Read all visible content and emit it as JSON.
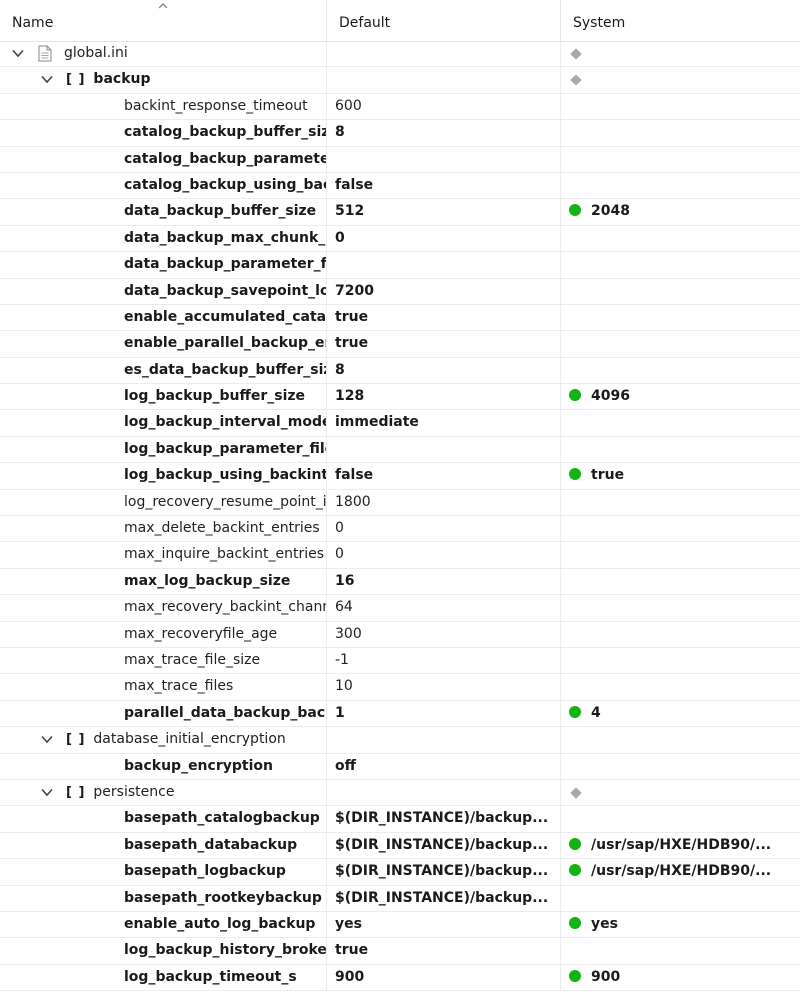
{
  "columns": {
    "name": "Name",
    "default": "Default",
    "system": "System"
  },
  "colors": {
    "green_dot": "#12b312",
    "gray_diamond": "#a9a9a9"
  },
  "rows": [
    {
      "type": "file",
      "name": "global.ini",
      "default": "",
      "system": "",
      "system_marker": "diamond"
    },
    {
      "type": "section",
      "name": "backup",
      "bold": true,
      "default": "",
      "system": "",
      "system_marker": "diamond"
    },
    {
      "type": "param",
      "name": "backint_response_timeout",
      "bold": false,
      "default": "600",
      "system": "",
      "system_marker": ""
    },
    {
      "type": "param",
      "name": "catalog_backup_buffer_size",
      "bold": true,
      "default": "8",
      "system": "",
      "system_marker": ""
    },
    {
      "type": "param",
      "name": "catalog_backup_parameter_file",
      "bold": true,
      "default": "",
      "system": "",
      "system_marker": ""
    },
    {
      "type": "param",
      "name": "catalog_backup_using_backint",
      "bold": true,
      "default": "false",
      "system": "",
      "system_marker": ""
    },
    {
      "type": "param",
      "name": "data_backup_buffer_size",
      "bold": true,
      "default": "512",
      "system": "2048",
      "system_marker": "green"
    },
    {
      "type": "param",
      "name": "data_backup_max_chunk_size",
      "bold": true,
      "default": "0",
      "system": "",
      "system_marker": ""
    },
    {
      "type": "param",
      "name": "data_backup_parameter_file",
      "bold": true,
      "default": "",
      "system": "",
      "system_marker": ""
    },
    {
      "type": "param",
      "name": "data_backup_savepoint_lock_timeout",
      "bold": true,
      "default": "7200",
      "system": "",
      "system_marker": ""
    },
    {
      "type": "param",
      "name": "enable_accumulated_catalog_backup",
      "bold": true,
      "default": "true",
      "system": "",
      "system_marker": ""
    },
    {
      "type": "param",
      "name": "enable_parallel_backup_encryption",
      "bold": true,
      "default": "true",
      "system": "",
      "system_marker": ""
    },
    {
      "type": "param",
      "name": "es_data_backup_buffer_size",
      "bold": true,
      "default": "8",
      "system": "",
      "system_marker": ""
    },
    {
      "type": "param",
      "name": "log_backup_buffer_size",
      "bold": true,
      "default": "128",
      "system": "4096",
      "system_marker": "green"
    },
    {
      "type": "param",
      "name": "log_backup_interval_mode",
      "bold": true,
      "default": "immediate",
      "system": "",
      "system_marker": ""
    },
    {
      "type": "param",
      "name": "log_backup_parameter_file",
      "bold": true,
      "default": "",
      "system": "",
      "system_marker": ""
    },
    {
      "type": "param",
      "name": "log_backup_using_backint",
      "bold": true,
      "default": "false",
      "system": "true",
      "system_marker": "green"
    },
    {
      "type": "param",
      "name": "log_recovery_resume_point_interval",
      "bold": false,
      "default": "1800",
      "system": "",
      "system_marker": ""
    },
    {
      "type": "param",
      "name": "max_delete_backint_entries",
      "bold": false,
      "default": "0",
      "system": "",
      "system_marker": ""
    },
    {
      "type": "param",
      "name": "max_inquire_backint_entries",
      "bold": false,
      "default": "0",
      "system": "",
      "system_marker": ""
    },
    {
      "type": "param",
      "name": "max_log_backup_size",
      "bold": true,
      "default": "16",
      "system": "",
      "system_marker": ""
    },
    {
      "type": "param",
      "name": "max_recovery_backint_channels",
      "bold": false,
      "default": "64",
      "system": "",
      "system_marker": ""
    },
    {
      "type": "param",
      "name": "max_recoveryfile_age",
      "bold": false,
      "default": "300",
      "system": "",
      "system_marker": ""
    },
    {
      "type": "param",
      "name": "max_trace_file_size",
      "bold": false,
      "default": "-1",
      "system": "",
      "system_marker": ""
    },
    {
      "type": "param",
      "name": "max_trace_files",
      "bold": false,
      "default": "10",
      "system": "",
      "system_marker": ""
    },
    {
      "type": "param",
      "name": "parallel_data_backup_backint_channels",
      "bold": true,
      "default": "1",
      "system": "4",
      "system_marker": "green"
    },
    {
      "type": "section",
      "name": "database_initial_encryption",
      "bold": false,
      "default": "",
      "system": "",
      "system_marker": ""
    },
    {
      "type": "param",
      "name": "backup_encryption",
      "bold": true,
      "default": "off",
      "system": "",
      "system_marker": ""
    },
    {
      "type": "section",
      "name": "persistence",
      "bold": false,
      "default": "",
      "system": "",
      "system_marker": "diamond"
    },
    {
      "type": "param",
      "name": "basepath_catalogbackup",
      "bold": true,
      "default": "$(DIR_INSTANCE)/backup...",
      "system": "",
      "system_marker": ""
    },
    {
      "type": "param",
      "name": "basepath_databackup",
      "bold": true,
      "default": "$(DIR_INSTANCE)/backup...",
      "system": "/usr/sap/HXE/HDB90/...",
      "system_marker": "green"
    },
    {
      "type": "param",
      "name": "basepath_logbackup",
      "bold": true,
      "default": "$(DIR_INSTANCE)/backup...",
      "system": "/usr/sap/HXE/HDB90/...",
      "system_marker": "green"
    },
    {
      "type": "param",
      "name": "basepath_rootkeybackup",
      "bold": true,
      "default": "$(DIR_INSTANCE)/backup...",
      "system": "",
      "system_marker": ""
    },
    {
      "type": "param",
      "name": "enable_auto_log_backup",
      "bold": true,
      "default": "yes",
      "system": "yes",
      "system_marker": "green"
    },
    {
      "type": "param",
      "name": "log_backup_history_broken",
      "bold": true,
      "default": "true",
      "system": "",
      "system_marker": ""
    },
    {
      "type": "param",
      "name": "log_backup_timeout_s",
      "bold": true,
      "default": "900",
      "system": "900",
      "system_marker": "green"
    }
  ]
}
